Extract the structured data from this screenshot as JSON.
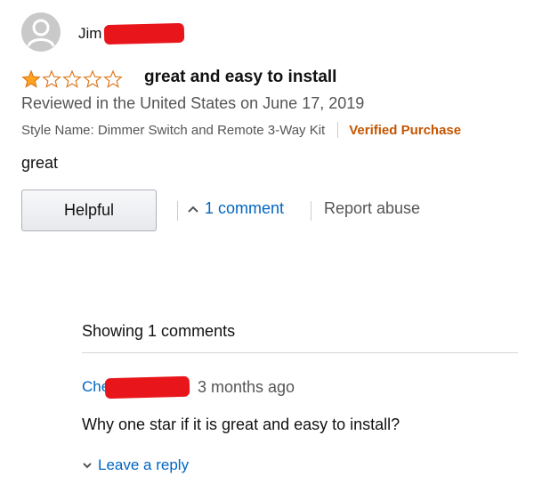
{
  "review": {
    "reviewer_name": "Jim",
    "rating": 1,
    "rating_max": 5,
    "title": "great and easy to install",
    "date_line": "Reviewed in the United States on June 17, 2019",
    "style_name": "Style Name: Dimmer Switch and Remote 3-Way Kit",
    "verified_label": "Verified Purchase",
    "body": "great"
  },
  "actions": {
    "helpful_label": "Helpful",
    "comment_link": "1 comment",
    "report_label": "Report abuse"
  },
  "comments": {
    "header": "Showing 1 comments",
    "items": [
      {
        "author": "Che",
        "time": "3 months ago",
        "text": "Why one star if it is great and easy to install?"
      }
    ],
    "reply_label": "Leave a reply"
  },
  "colors": {
    "star_fill": "#ffa41c",
    "link": "#0066c0",
    "verified": "#c45500",
    "redaction": "#e8161b"
  },
  "icons": [
    "avatar-icon",
    "star-icon",
    "caret-up-icon",
    "caret-down-icon"
  ]
}
